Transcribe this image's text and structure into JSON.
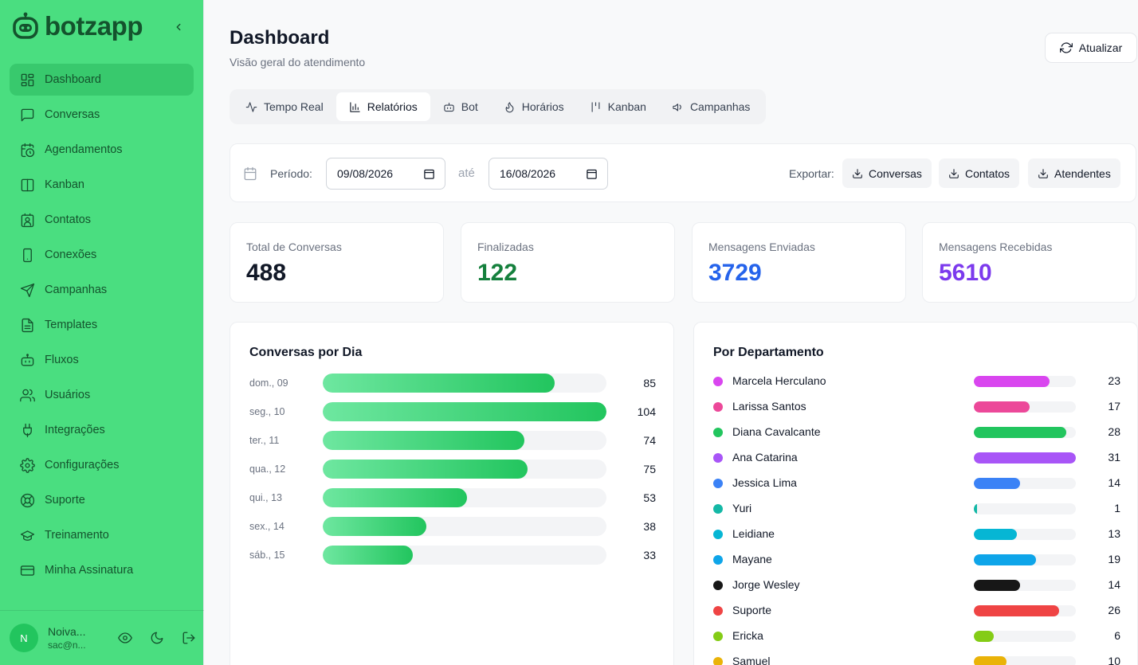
{
  "brand": {
    "name": "botzapp"
  },
  "sidebar": {
    "items": [
      {
        "label": "Dashboard",
        "icon": "grid-icon",
        "active": true
      },
      {
        "label": "Conversas",
        "icon": "message-square-icon"
      },
      {
        "label": "Agendamentos",
        "icon": "calendar-clock-icon"
      },
      {
        "label": "Kanban",
        "icon": "columns-icon"
      },
      {
        "label": "Contatos",
        "icon": "contact-card-icon"
      },
      {
        "label": "Conexões",
        "icon": "smartphone-icon"
      },
      {
        "label": "Campanhas",
        "icon": "send-icon"
      },
      {
        "label": "Templates",
        "icon": "file-text-icon"
      },
      {
        "label": "Fluxos",
        "icon": "bot-icon"
      },
      {
        "label": "Usuários",
        "icon": "users-icon"
      },
      {
        "label": "Integrações",
        "icon": "plug-icon"
      },
      {
        "label": "Configurações",
        "icon": "gear-icon"
      },
      {
        "label": "Suporte",
        "icon": "life-buoy-icon"
      },
      {
        "label": "Treinamento",
        "icon": "graduation-cap-icon"
      },
      {
        "label": "Minha Assinatura",
        "icon": "credit-card-icon"
      }
    ],
    "user": {
      "initial": "N",
      "name": "Noiva...",
      "email": "sac@n..."
    }
  },
  "header": {
    "title": "Dashboard",
    "subtitle": "Visão geral do atendimento",
    "refresh_label": "Atualizar"
  },
  "tabs": [
    {
      "label": "Tempo Real",
      "icon": "activity-icon"
    },
    {
      "label": "Relatórios",
      "icon": "bar-chart-icon",
      "active": true
    },
    {
      "label": "Bot",
      "icon": "bot-icon"
    },
    {
      "label": "Horários",
      "icon": "flame-icon"
    },
    {
      "label": "Kanban",
      "icon": "kanban-icon"
    },
    {
      "label": "Campanhas",
      "icon": "megaphone-icon"
    }
  ],
  "filters": {
    "period_label": "Período:",
    "start_date": "09/08/2026",
    "separator": "até",
    "end_date": "16/08/2026",
    "export_label": "Exportar:",
    "export_buttons": [
      "Conversas",
      "Contatos",
      "Atendentes"
    ]
  },
  "stats": [
    {
      "label": "Total de Conversas",
      "value": "488",
      "color": "#111827"
    },
    {
      "label": "Finalizadas",
      "value": "122",
      "color": "#15803d"
    },
    {
      "label": "Mensagens Enviadas",
      "value": "3729",
      "color": "#2563eb"
    },
    {
      "label": "Mensagens Recebidas",
      "value": "5610",
      "color": "#7c3aed"
    }
  ],
  "chart_data": [
    {
      "type": "bar",
      "title": "Conversas por Dia",
      "categories": [
        "dom., 09",
        "seg., 10",
        "ter., 11",
        "qua., 12",
        "qui., 13",
        "sex., 14",
        "sáb., 15"
      ],
      "values": [
        85,
        104,
        74,
        75,
        53,
        38,
        33
      ],
      "max": 104,
      "color": "#22c55e"
    },
    {
      "type": "bar",
      "title": "Por Departamento",
      "categories": [
        "Marcela Herculano",
        "Larissa Santos",
        "Diana Cavalcante",
        "Ana Catarina",
        "Jessica Lima",
        "Yuri",
        "Leidiane",
        "Mayane",
        "Jorge Wesley",
        "Suporte",
        "Ericka",
        "Samuel"
      ],
      "values": [
        23,
        17,
        28,
        31,
        14,
        1,
        13,
        19,
        14,
        26,
        6,
        10
      ],
      "max": 31,
      "colors": [
        "#d946ef",
        "#ec4899",
        "#22c55e",
        "#a855f7",
        "#3b82f6",
        "#14b8a6",
        "#06b6d4",
        "#0ea5e9",
        "#171717",
        "#ef4444",
        "#84cc16",
        "#eab308"
      ]
    }
  ]
}
